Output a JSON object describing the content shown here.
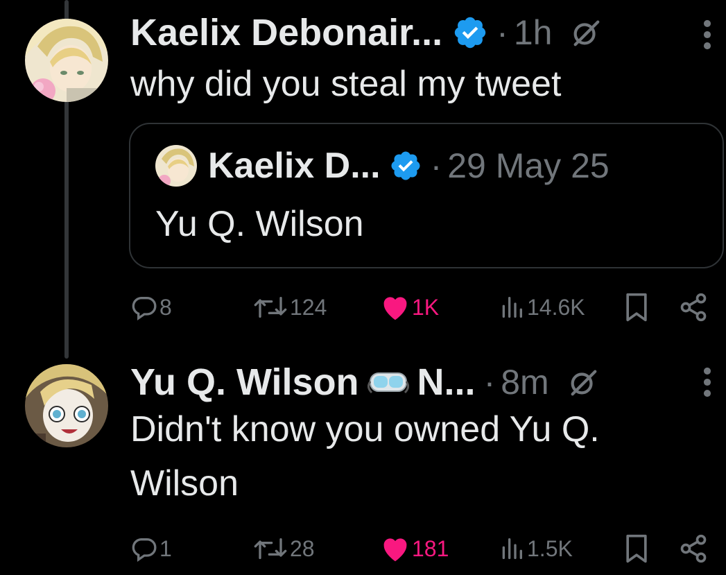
{
  "tweets": [
    {
      "author": "Kaelix Debonair...",
      "time": "1h",
      "text": "why did you steal my tweet",
      "quote": {
        "author": "Kaelix D...",
        "date": "29 May 25",
        "text": "Yu Q. Wilson"
      },
      "replies": "8",
      "reposts": "124",
      "likes": "1K",
      "views": "14.6K"
    },
    {
      "author": "Yu Q. Wilson",
      "author_suffix": "N...",
      "time": "8m",
      "text": "Didn't know you owned Yu Q. Wilson",
      "replies": "1",
      "reposts": "28",
      "likes": "181",
      "views": "1.5K"
    }
  ],
  "icons": {
    "verified": "verified-badge-icon",
    "grok": "grok-icon",
    "more": "more-icon",
    "reply": "reply-icon",
    "repost": "repost-icon",
    "like": "heart-icon",
    "views": "views-icon",
    "bookmark": "bookmark-icon",
    "share": "share-icon",
    "goggles": "goggles-emoji-icon"
  },
  "colors": {
    "background": "#000000",
    "text": "#e7e9ea",
    "muted": "#71767b",
    "verified": "#1d9bf0",
    "like": "#f91880",
    "border": "#2f3336"
  }
}
